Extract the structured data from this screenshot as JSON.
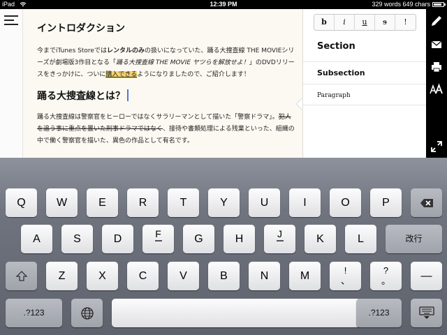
{
  "status": {
    "carrier": "iPad",
    "time": "12:39 PM",
    "counts": "329 words  649 chars"
  },
  "editor": {
    "heading1": "イントロダクション",
    "intro": {
      "p1": "今まで",
      "p2": "iTunes Store",
      "p3": "では",
      "p4": "レンタルのみ",
      "p5": "の扱いになっていた、踊る大捜査線 THE MOVIEシリーズが劇場版3作目となる「",
      "p6": "踊る大捜査線 THE MOVIE ヤツらを解放せよ！",
      "p7": "」のDVDリリースをきっかけに、ついに",
      "p8": "購入できる",
      "p9": "ようになりましたので、ご紹介します！"
    },
    "heading2": "踊る大捜査線とは？",
    "body": {
      "p1": "踊る大捜査線は警察官をヒーローではなくサラリーマンとして描いた「警察ドラマ」。",
      "p2": "犯人を追う事に重点を置いた刑事ドラマではなく",
      "p3": "、接待や書類処理による残業といった、組織の中で働く警察官を描いた、異色の作品として有名です。"
    }
  },
  "panel": {
    "format_buttons": [
      "b",
      "i",
      "u",
      "s",
      "!"
    ],
    "styles": {
      "section": "Section",
      "subsection": "Subsection",
      "paragraph": "Paragraph"
    }
  },
  "keyboard": {
    "row1": [
      "Q",
      "W",
      "E",
      "R",
      "T",
      "Y",
      "U",
      "I",
      "O",
      "P"
    ],
    "row2": [
      "A",
      "S",
      "D",
      "F",
      "G",
      "H",
      "J",
      "K",
      "L"
    ],
    "return_label": "改行",
    "row3": [
      "Z",
      "X",
      "C",
      "V",
      "B",
      "N",
      "M"
    ],
    "exclaim_top": "!",
    "exclaim_bottom": "、",
    "question_top": "?",
    "question_bottom": "。",
    "dash": "—",
    "num_left": ".?123",
    "num_right": ".?123"
  },
  "colors": {
    "highlight": "#f6d36b",
    "cursor": "#4a7bd6"
  }
}
